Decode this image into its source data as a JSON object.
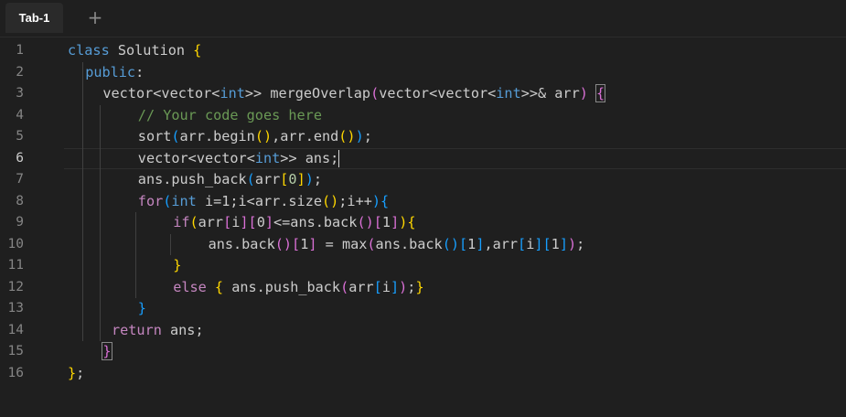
{
  "tabs": [
    {
      "label": "Tab-1"
    }
  ],
  "add_tab_label": "+",
  "editor": {
    "lines": [
      {
        "n": "1",
        "indent": 0,
        "tokens": [
          [
            "class ",
            "#569cd6"
          ],
          [
            "Solution ",
            "#cccccc"
          ],
          [
            "{",
            "#ffd700"
          ]
        ]
      },
      {
        "n": "2",
        "indent": 1,
        "tokens": [
          [
            "public",
            "#569cd6"
          ],
          [
            ":",
            "#cccccc"
          ]
        ]
      },
      {
        "n": "3",
        "indent": 2,
        "tokens": [
          [
            "vector",
            "#cccccc"
          ],
          [
            "<",
            "#cccccc"
          ],
          [
            "vector",
            "#cccccc"
          ],
          [
            "<",
            "#cccccc"
          ],
          [
            "int",
            "#569cd6"
          ],
          [
            ">> ",
            "#cccccc"
          ],
          [
            "mergeOverlap",
            "#cccccc"
          ],
          [
            "(",
            "#da70d6"
          ],
          [
            "vector",
            "#cccccc"
          ],
          [
            "<",
            "#cccccc"
          ],
          [
            "vector",
            "#cccccc"
          ],
          [
            "<",
            "#cccccc"
          ],
          [
            "int",
            "#569cd6"
          ],
          [
            ">>& arr",
            "#cccccc"
          ],
          [
            ")",
            "#da70d6"
          ],
          [
            " ",
            "#cccccc"
          ],
          [
            "{",
            "#da70d6",
            "bm"
          ]
        ]
      },
      {
        "n": "4",
        "indent": 4,
        "tokens": [
          [
            "// Your code goes here",
            "#6a9955"
          ]
        ]
      },
      {
        "n": "5",
        "indent": 4,
        "tokens": [
          [
            "sort",
            "#cccccc"
          ],
          [
            "(",
            "#179fff"
          ],
          [
            "arr.begin",
            "#cccccc"
          ],
          [
            "()",
            "#ffd700"
          ],
          [
            ",arr.end",
            "#cccccc"
          ],
          [
            "()",
            "#ffd700"
          ],
          [
            ")",
            "#179fff"
          ],
          [
            ";",
            "#cccccc"
          ]
        ]
      },
      {
        "n": "6",
        "indent": 4,
        "current": true,
        "tokens": [
          [
            "vector",
            "#cccccc"
          ],
          [
            "<",
            "#cccccc"
          ],
          [
            "vector",
            "#cccccc"
          ],
          [
            "<",
            "#cccccc"
          ],
          [
            "int",
            "#569cd6"
          ],
          [
            ">> ans;",
            "#cccccc"
          ]
        ]
      },
      {
        "n": "7",
        "indent": 4,
        "tokens": [
          [
            "ans.push_back",
            "#cccccc"
          ],
          [
            "(",
            "#179fff"
          ],
          [
            "arr",
            "#cccccc"
          ],
          [
            "[",
            "#ffd700"
          ],
          [
            "0",
            "#b5cea8"
          ],
          [
            "]",
            "#ffd700"
          ],
          [
            ")",
            "#179fff"
          ],
          [
            ";",
            "#cccccc"
          ]
        ]
      },
      {
        "n": "8",
        "indent": 4,
        "tokens": [
          [
            "for",
            "#c586c0"
          ],
          [
            "(",
            "#179fff"
          ],
          [
            "int ",
            "#569cd6"
          ],
          [
            "i=1;i<arr.size",
            "#cccccc"
          ],
          [
            "()",
            "#ffd700"
          ],
          [
            ";i++",
            "#cccccc"
          ],
          [
            ")",
            "#179fff"
          ],
          [
            "{",
            "#179fff"
          ]
        ]
      },
      {
        "n": "9",
        "indent": 6,
        "tokens": [
          [
            "if",
            "#c586c0"
          ],
          [
            "(",
            "#ffd700"
          ],
          [
            "arr",
            "#cccccc"
          ],
          [
            "[",
            "#da70d6"
          ],
          [
            "i",
            "#cccccc"
          ],
          [
            "]",
            "#da70d6"
          ],
          [
            "[",
            "#da70d6"
          ],
          [
            "0",
            "#cccccc"
          ],
          [
            "]",
            "#da70d6"
          ],
          [
            "<=ans.back",
            "#cccccc"
          ],
          [
            "()",
            "#da70d6"
          ],
          [
            "[",
            "#da70d6"
          ],
          [
            "1",
            "#cccccc"
          ],
          [
            "]",
            "#da70d6"
          ],
          [
            ")",
            "#ffd700"
          ],
          [
            "{",
            "#ffd700"
          ]
        ]
      },
      {
        "n": "10",
        "indent": 8,
        "tokens": [
          [
            "ans.back",
            "#cccccc"
          ],
          [
            "()",
            "#da70d6"
          ],
          [
            "[",
            "#da70d6"
          ],
          [
            "1",
            "#cccccc"
          ],
          [
            "]",
            "#da70d6"
          ],
          [
            " = max",
            "#cccccc"
          ],
          [
            "(",
            "#da70d6"
          ],
          [
            "ans.back",
            "#cccccc"
          ],
          [
            "()",
            "#179fff"
          ],
          [
            "[",
            "#179fff"
          ],
          [
            "1",
            "#cccccc"
          ],
          [
            "]",
            "#179fff"
          ],
          [
            ",arr",
            "#cccccc"
          ],
          [
            "[",
            "#179fff"
          ],
          [
            "i",
            "#cccccc"
          ],
          [
            "]",
            "#179fff"
          ],
          [
            "[",
            "#179fff"
          ],
          [
            "1",
            "#cccccc"
          ],
          [
            "]",
            "#179fff"
          ],
          [
            ")",
            "#da70d6"
          ],
          [
            ";",
            "#cccccc"
          ]
        ]
      },
      {
        "n": "11",
        "indent": 6,
        "tokens": [
          [
            "}",
            "#ffd700"
          ]
        ]
      },
      {
        "n": "12",
        "indent": 6,
        "tokens": [
          [
            "else ",
            "#c586c0"
          ],
          [
            "{",
            "#ffd700"
          ],
          [
            " ans.push_back",
            "#cccccc"
          ],
          [
            "(",
            "#da70d6"
          ],
          [
            "arr",
            "#cccccc"
          ],
          [
            "[",
            "#179fff"
          ],
          [
            "i",
            "#cccccc"
          ],
          [
            "]",
            "#179fff"
          ],
          [
            ")",
            "#da70d6"
          ],
          [
            ";",
            "#cccccc"
          ],
          [
            "}",
            "#ffd700"
          ]
        ]
      },
      {
        "n": "13",
        "indent": 4,
        "tokens": [
          [
            "}",
            "#179fff"
          ]
        ]
      },
      {
        "n": "14",
        "indent": 2.5,
        "tokens": [
          [
            "return ",
            "#c586c0"
          ],
          [
            "ans;",
            "#cccccc"
          ]
        ]
      },
      {
        "n": "15",
        "indent": 2,
        "tokens": [
          [
            "}",
            "#da70d6",
            "bm"
          ]
        ]
      },
      {
        "n": "16",
        "indent": 0,
        "tokens": [
          [
            "}",
            "#ffd700"
          ],
          [
            ";",
            "#cccccc"
          ]
        ]
      }
    ]
  }
}
